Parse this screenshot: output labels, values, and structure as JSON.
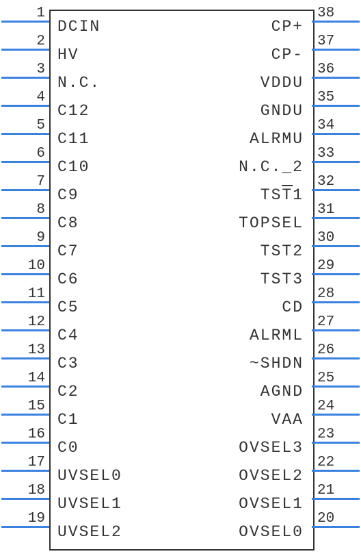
{
  "chart_data": {
    "type": "table",
    "title": "IC pinout diagram",
    "pins_left": [
      {
        "num": "1",
        "label": "DCIN"
      },
      {
        "num": "2",
        "label": "HV"
      },
      {
        "num": "3",
        "label": "N.C."
      },
      {
        "num": "4",
        "label": "C12"
      },
      {
        "num": "5",
        "label": "C11"
      },
      {
        "num": "6",
        "label": "C10"
      },
      {
        "num": "7",
        "label": "C9"
      },
      {
        "num": "8",
        "label": "C8"
      },
      {
        "num": "9",
        "label": "C7"
      },
      {
        "num": "10",
        "label": "C6"
      },
      {
        "num": "11",
        "label": "C5"
      },
      {
        "num": "12",
        "label": "C4"
      },
      {
        "num": "13",
        "label": "C3"
      },
      {
        "num": "14",
        "label": "C2"
      },
      {
        "num": "15",
        "label": "C1"
      },
      {
        "num": "16",
        "label": "C0"
      },
      {
        "num": "17",
        "label": "UVSEL0"
      },
      {
        "num": "18",
        "label": "UVSEL1"
      },
      {
        "num": "19",
        "label": "UVSEL2"
      }
    ],
    "pins_right": [
      {
        "num": "38",
        "label": "CP+"
      },
      {
        "num": "37",
        "label": "CP-"
      },
      {
        "num": "36",
        "label": "VDDU"
      },
      {
        "num": "35",
        "label": "GNDU"
      },
      {
        "num": "34",
        "label": "ALRMU"
      },
      {
        "num": "33",
        "label": "N.C._2"
      },
      {
        "num": "32",
        "label": "TST1",
        "overline": "T"
      },
      {
        "num": "31",
        "label": "TOPSEL"
      },
      {
        "num": "30",
        "label": "TST2"
      },
      {
        "num": "29",
        "label": "TST3"
      },
      {
        "num": "28",
        "label": "CD"
      },
      {
        "num": "27",
        "label": "ALRML"
      },
      {
        "num": "26",
        "label": "~SHDN"
      },
      {
        "num": "25",
        "label": "AGND"
      },
      {
        "num": "24",
        "label": "VAA"
      },
      {
        "num": "23",
        "label": "OVSEL3"
      },
      {
        "num": "22",
        "label": "OVSEL2"
      },
      {
        "num": "21",
        "label": "OVSEL1"
      },
      {
        "num": "20",
        "label": "OVSEL0"
      }
    ]
  }
}
